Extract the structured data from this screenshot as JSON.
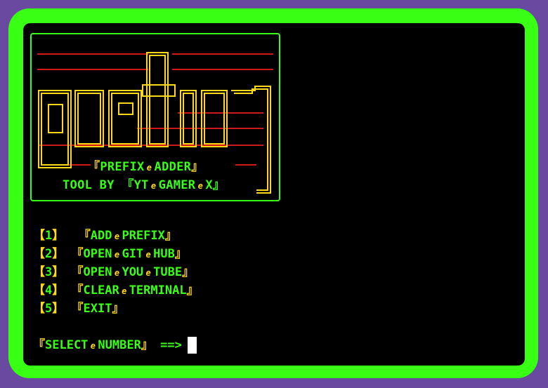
{
  "banner": {
    "logo_text": "prefix",
    "title_tokens": [
      "PREFIX",
      "ADDER"
    ],
    "byline_tokens": [
      "TOOL BY 『YT",
      "GAMER",
      "X』"
    ]
  },
  "separator_glyph": "e",
  "menu": [
    {
      "num": "1",
      "tokens": [
        "ADD",
        "PREFIX"
      ]
    },
    {
      "num": "2",
      "tokens": [
        "OPEN",
        "GIT",
        "HUB"
      ]
    },
    {
      "num": "3",
      "tokens": [
        "OPEN",
        "YOU",
        "TUBE"
      ]
    },
    {
      "num": "4",
      "tokens": [
        "CLEAR",
        "TERMINAL"
      ]
    },
    {
      "num": "5",
      "tokens": [
        "EXIT"
      ]
    }
  ],
  "prompt": {
    "tokens": [
      "SELECT",
      "NUMBER"
    ],
    "arrow": "==>"
  },
  "colors": {
    "frame": "#39ff14",
    "background": "#6a4aa0",
    "text": "#39ff14",
    "bracket": "#ffd81a",
    "lines": "#d01818"
  }
}
